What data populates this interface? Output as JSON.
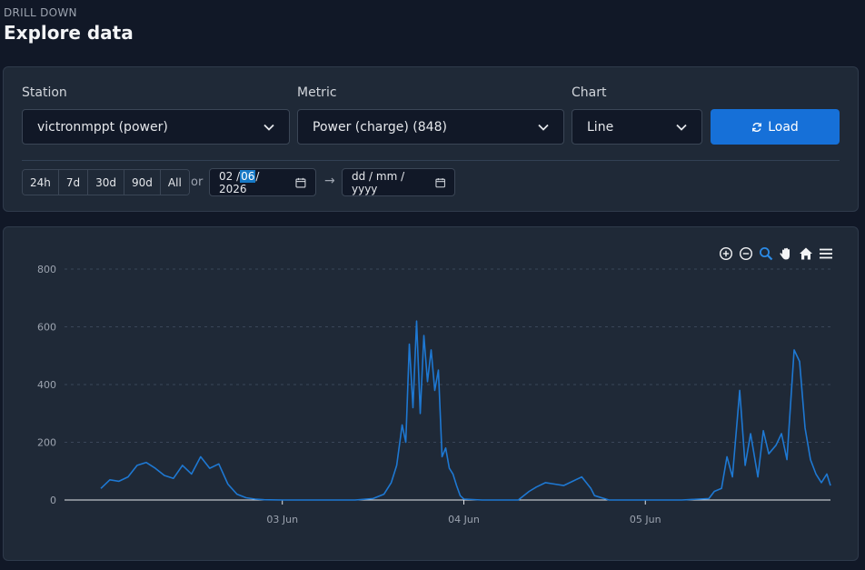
{
  "header": {
    "eyebrow": "DRILL DOWN",
    "title": "Explore data"
  },
  "controls": {
    "station": {
      "label": "Station",
      "value": "victronmppt (power)"
    },
    "metric": {
      "label": "Metric",
      "value": "Power (charge) (848)"
    },
    "chart": {
      "label": "Chart",
      "value": "Line"
    },
    "load_label": "Load",
    "ranges": [
      "24h",
      "7d",
      "30d",
      "90d",
      "All"
    ],
    "or_label": "or",
    "start_date": {
      "day": "02",
      "month": "06",
      "year": "2026"
    },
    "end_date_placeholder": "dd / mm / yyyy",
    "arrow": "→"
  },
  "toolbar_icons": [
    "zoom-in-icon",
    "zoom-out-icon",
    "zoom-select-icon",
    "pan-icon",
    "reset-home-icon",
    "menu-icon"
  ],
  "colors": {
    "accent": "#1670d8",
    "series": "#1e78d2",
    "background": "#111827",
    "card": "#1f2937"
  },
  "chart_data": {
    "type": "line",
    "series": [
      {
        "x": [
          2.0,
          2.05,
          2.1,
          2.15,
          2.2,
          2.25,
          2.3,
          2.35,
          2.4,
          2.45,
          2.5,
          2.55,
          2.6,
          2.65,
          2.7,
          2.75,
          2.8,
          2.85,
          2.9,
          3.0,
          3.2,
          3.4,
          3.5,
          3.56,
          3.6,
          3.63,
          3.66,
          3.68,
          3.7,
          3.72,
          3.74,
          3.76,
          3.78,
          3.8,
          3.82,
          3.84,
          3.86,
          3.88,
          3.9,
          3.92,
          3.94,
          3.96,
          3.98,
          4.0,
          4.1,
          4.3,
          4.33,
          4.36,
          4.4,
          4.45,
          4.5,
          4.55,
          4.6,
          4.65,
          4.7,
          4.72,
          4.8,
          5.0,
          5.2,
          5.35,
          5.38,
          5.42,
          5.45,
          5.48,
          5.52,
          5.55,
          5.58,
          5.62,
          5.65,
          5.68,
          5.72,
          5.75,
          5.78,
          5.82,
          5.85,
          5.88,
          5.91,
          5.94,
          5.97,
          6.0,
          6.02
        ],
        "y": [
          40,
          70,
          65,
          80,
          120,
          130,
          110,
          85,
          75,
          120,
          90,
          150,
          110,
          125,
          55,
          20,
          8,
          3,
          1,
          0,
          0,
          0,
          5,
          20,
          60,
          120,
          260,
          200,
          540,
          320,
          620,
          300,
          570,
          410,
          520,
          380,
          450,
          150,
          180,
          110,
          90,
          50,
          15,
          3,
          0,
          0,
          15,
          30,
          45,
          60,
          55,
          50,
          65,
          80,
          40,
          15,
          0,
          0,
          0,
          5,
          30,
          40,
          150,
          80,
          380,
          120,
          230,
          80,
          240,
          160,
          190,
          230,
          140,
          520,
          480,
          250,
          140,
          90,
          60,
          90,
          50
        ]
      }
    ],
    "x_ticks": [
      "03 Jun",
      "04 Jun",
      "05 Jun"
    ],
    "y_ticks": [
      0,
      200,
      400,
      600,
      800
    ],
    "ylim": [
      0,
      800
    ],
    "grid": true
  }
}
